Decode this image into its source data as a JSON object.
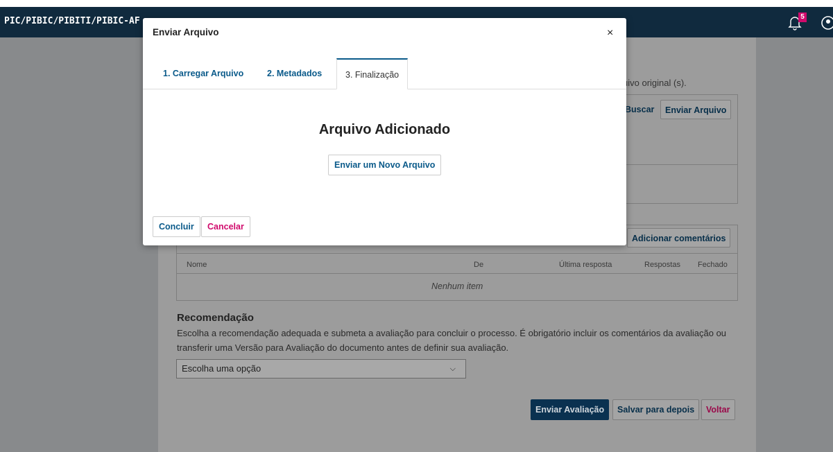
{
  "header": {
    "brand": "PIC/PIBIC/PIBITI/PIBIC-AF",
    "notification_count": "5",
    "icons": {
      "bell": "bell-icon",
      "user": "user-icon"
    }
  },
  "background": {
    "file_note": "uivo original (s).",
    "files_toolbar": {
      "search_label": "Buscar",
      "upload_label": "Enviar Arquivo"
    },
    "discussions": {
      "add_comments_label": "Adicionar comentários",
      "columns": [
        "Nome",
        "De",
        "Última resposta",
        "Respostas",
        "Fechado"
      ],
      "empty_text": "Nenhum item"
    },
    "recommendation": {
      "title": "Recomendação",
      "description": "Escolha a recomendação adequada e submeta a avaliação para concluir o processo. É obrigatório incluir os comentários da avaliação ou transferir uma Versão para Avaliação do documento antes de definir sua avaliação.",
      "select_value": "Escolha uma opção"
    },
    "actions": {
      "submit": "Enviar Avaliação",
      "save": "Salvar para depois",
      "back": "Voltar"
    }
  },
  "modal": {
    "title": "Enviar Arquivo",
    "close": "×",
    "tabs": [
      {
        "label": "1. Carregar Arquivo"
      },
      {
        "label": "2. Metadados"
      },
      {
        "label": "3. Finalização"
      }
    ],
    "heading": "Arquivo Adicionado",
    "new_file_label": "Enviar um Novo Arquivo",
    "finish_label": "Concluir",
    "cancel_label": "Cancelar"
  },
  "colors": {
    "header": "#102a3e",
    "accent": "#0a5a8a",
    "danger": "#d00a6c",
    "primary": "#0a3150"
  }
}
